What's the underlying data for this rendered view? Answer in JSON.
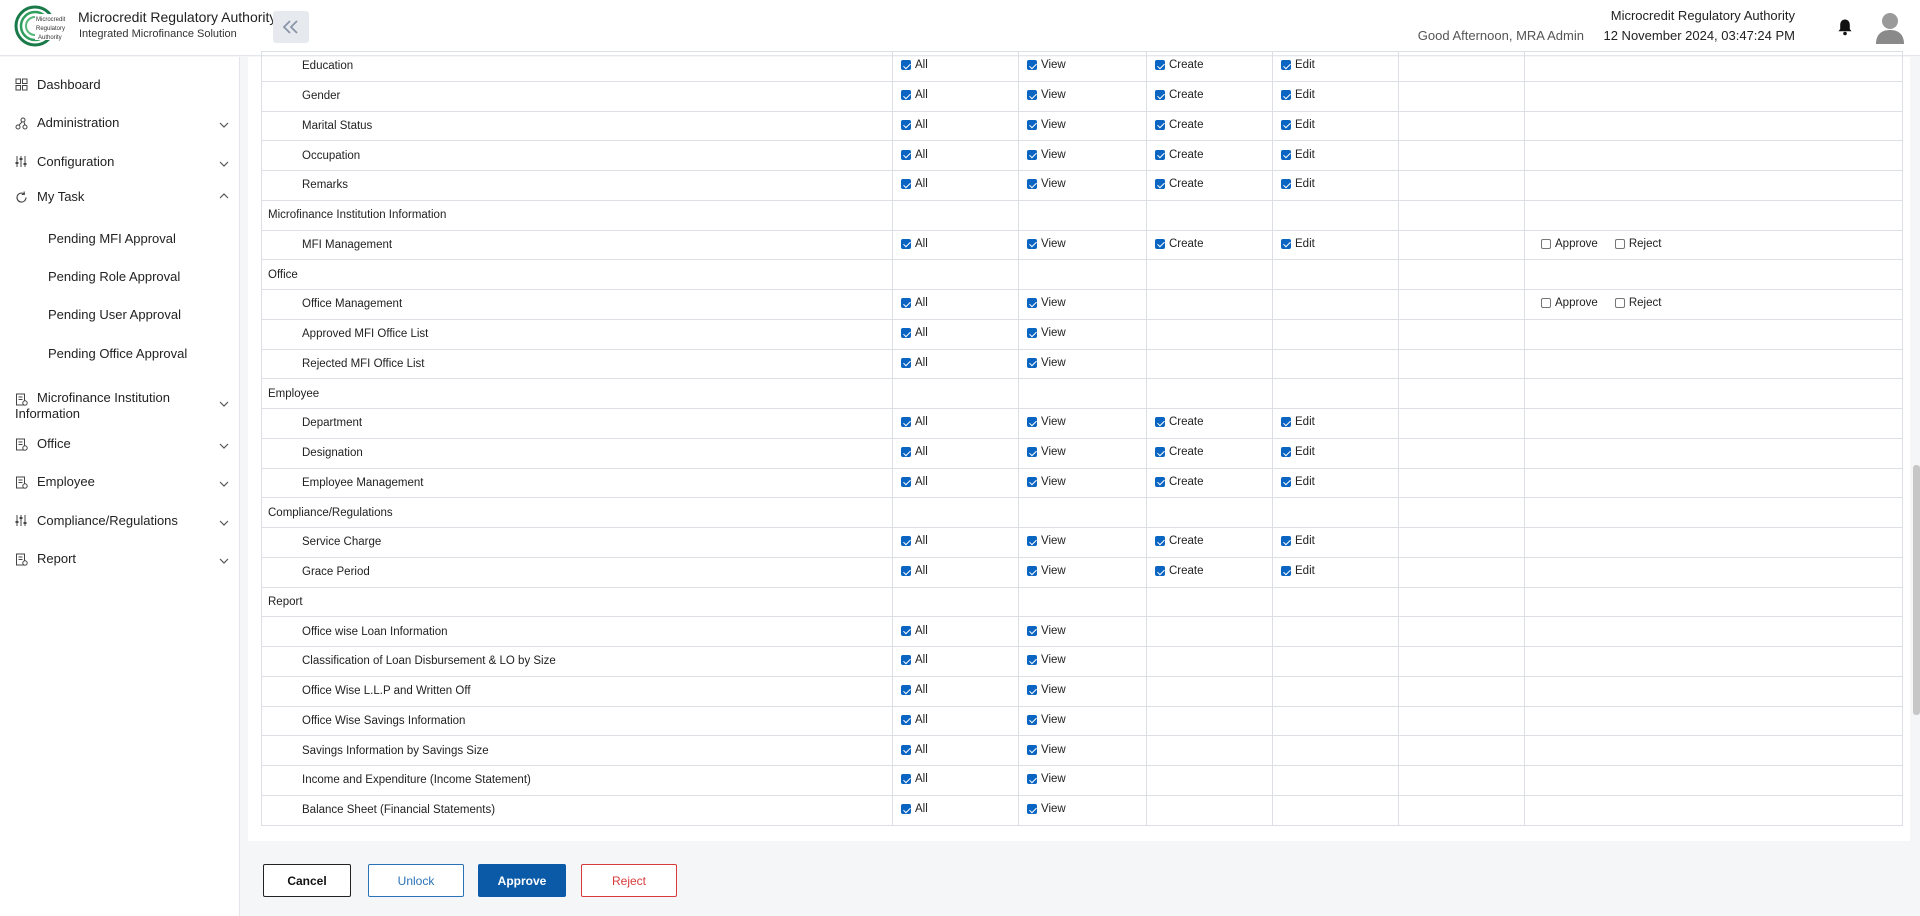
{
  "header": {
    "logo_text": [
      "Microcredit",
      "Regulatory",
      "Authority"
    ],
    "brand_title": "Microcredit Regulatory Authority",
    "brand_subtitle": "Integrated Microfinance Solution",
    "greeting": "Good Afternoon, MRA Admin",
    "org_name": "Microcredit Regulatory Authority",
    "datetime": "12 November 2024, 03:47:24 PM",
    "accent_color": "#0a5aa8"
  },
  "sidebar": {
    "items": [
      {
        "label": "Dashboard",
        "icon": "grid-icon"
      },
      {
        "label": "Administration",
        "icon": "hierarchy-icon"
      },
      {
        "label": "Configuration",
        "icon": "sliders-icon"
      },
      {
        "label": "My Task",
        "icon": "refresh-icon"
      },
      {
        "label": "Microfinance Institution Information",
        "icon": "document-icon"
      },
      {
        "label": "Office",
        "icon": "document-icon"
      },
      {
        "label": "Employee",
        "icon": "document-icon"
      },
      {
        "label": "Compliance/Regulations",
        "icon": "sliders-icon"
      },
      {
        "label": "Report",
        "icon": "document-icon"
      }
    ],
    "subitems": [
      "Pending MFI Approval",
      "Pending Role Approval",
      "Pending User Approval",
      "Pending Office Approval"
    ]
  },
  "permissions": {
    "labels": {
      "all": "All",
      "view": "View",
      "create": "Create",
      "edit": "Edit",
      "approve": "Approve",
      "reject": "Reject"
    },
    "rows": [
      {
        "type": "sub",
        "name": "Education",
        "perms": [
          "all",
          "view",
          "create",
          "edit"
        ],
        "approval": false
      },
      {
        "type": "sub",
        "name": "Gender",
        "perms": [
          "all",
          "view",
          "create",
          "edit"
        ],
        "approval": false
      },
      {
        "type": "sub",
        "name": "Marital Status",
        "perms": [
          "all",
          "view",
          "create",
          "edit"
        ],
        "approval": false
      },
      {
        "type": "sub",
        "name": "Occupation",
        "perms": [
          "all",
          "view",
          "create",
          "edit"
        ],
        "approval": false
      },
      {
        "type": "sub",
        "name": "Remarks",
        "perms": [
          "all",
          "view",
          "create",
          "edit"
        ],
        "approval": false
      },
      {
        "type": "cat",
        "name": "Microfinance Institution Information"
      },
      {
        "type": "sub",
        "name": "MFI Management",
        "perms": [
          "all",
          "view",
          "create",
          "edit"
        ],
        "approval": true
      },
      {
        "type": "cat",
        "name": "Office"
      },
      {
        "type": "sub",
        "name": "Office Management",
        "perms": [
          "all",
          "view"
        ],
        "approval": true
      },
      {
        "type": "sub",
        "name": "Approved MFI Office List",
        "perms": [
          "all",
          "view"
        ],
        "approval": false
      },
      {
        "type": "sub",
        "name": "Rejected MFI Office List",
        "perms": [
          "all",
          "view"
        ],
        "approval": false
      },
      {
        "type": "cat",
        "name": "Employee"
      },
      {
        "type": "sub",
        "name": "Department",
        "perms": [
          "all",
          "view",
          "create",
          "edit"
        ],
        "approval": false
      },
      {
        "type": "sub",
        "name": "Designation",
        "perms": [
          "all",
          "view",
          "create",
          "edit"
        ],
        "approval": false
      },
      {
        "type": "sub",
        "name": "Employee Management",
        "perms": [
          "all",
          "view",
          "create",
          "edit"
        ],
        "approval": false
      },
      {
        "type": "cat",
        "name": "Compliance/Regulations"
      },
      {
        "type": "sub",
        "name": "Service Charge",
        "perms": [
          "all",
          "view",
          "create",
          "edit"
        ],
        "approval": false
      },
      {
        "type": "sub",
        "name": "Grace Period",
        "perms": [
          "all",
          "view",
          "create",
          "edit"
        ],
        "approval": false
      },
      {
        "type": "cat",
        "name": "Report"
      },
      {
        "type": "sub",
        "name": "Office wise Loan Information",
        "perms": [
          "all",
          "view"
        ],
        "approval": false
      },
      {
        "type": "sub",
        "name": "Classification of Loan Disbursement & LO by Size",
        "perms": [
          "all",
          "view"
        ],
        "approval": false
      },
      {
        "type": "sub",
        "name": "Office Wise L.L.P and Written Off",
        "perms": [
          "all",
          "view"
        ],
        "approval": false
      },
      {
        "type": "sub",
        "name": "Office Wise Savings Information",
        "perms": [
          "all",
          "view"
        ],
        "approval": false
      },
      {
        "type": "sub",
        "name": "Savings Information by Savings Size",
        "perms": [
          "all",
          "view"
        ],
        "approval": false
      },
      {
        "type": "sub",
        "name": "Income and Expenditure (Income Statement)",
        "perms": [
          "all",
          "view"
        ],
        "approval": false
      },
      {
        "type": "sub",
        "name": "Balance Sheet (Financial Statements)",
        "perms": [
          "all",
          "view"
        ],
        "approval": false
      }
    ]
  },
  "footer": {
    "cancel": "Cancel",
    "unlock": "Unlock",
    "approve": "Approve",
    "reject": "Reject"
  }
}
